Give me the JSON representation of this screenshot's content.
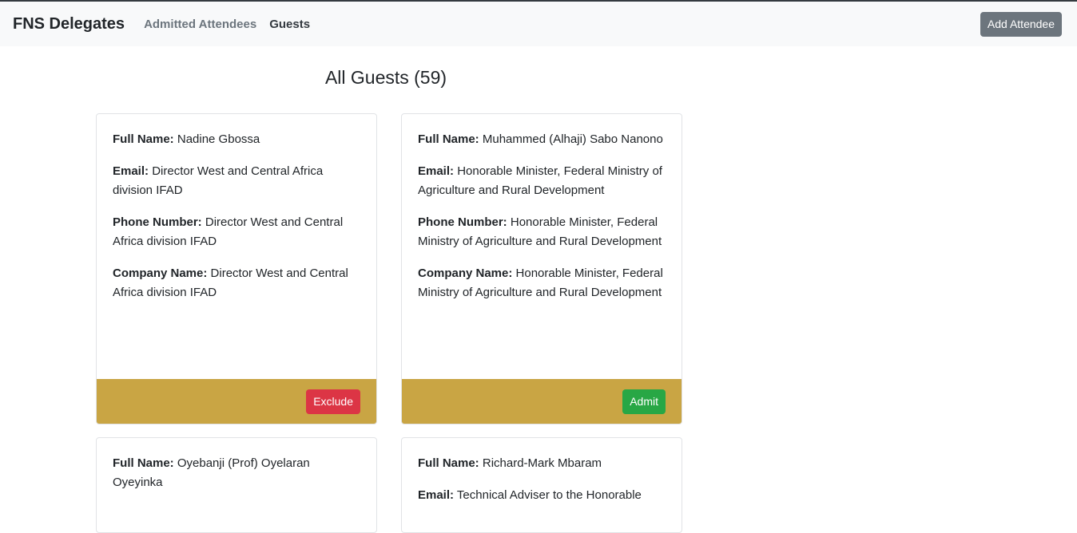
{
  "navbar": {
    "brand": "FNS Delegates",
    "links": [
      "Admitted Attendees",
      "Guests"
    ],
    "add_button": "Add Attendee"
  },
  "main": {
    "title": "All Guests (59)",
    "labels": {
      "full_name": "Full Name:",
      "email": "Email:",
      "phone": "Phone Number:",
      "company": "Company Name:"
    },
    "cards": [
      {
        "full_name": "Nadine Gbossa",
        "email": "Director West and Central Africa division IFAD",
        "phone": "Director West and Central Africa division IFAD",
        "company": "Director West and Central Africa division IFAD",
        "action": "Exclude"
      },
      {
        "full_name": "Muhammed (Alhaji) Sabo Nanono",
        "email": "Honorable Minister, Federal Ministry of Agriculture and Rural Development",
        "phone": "Honorable Minister, Federal Ministry of Agriculture and Rural Development",
        "company": "Honorable Minister, Federal Ministry of Agriculture and Rural Development",
        "action": "Admit"
      },
      {
        "full_name": "Oyebanji (Prof) Oyelaran Oyeyinka"
      },
      {
        "full_name": "Richard-Mark Mbaram",
        "email": "Technical Adviser to the Honorable"
      }
    ]
  }
}
